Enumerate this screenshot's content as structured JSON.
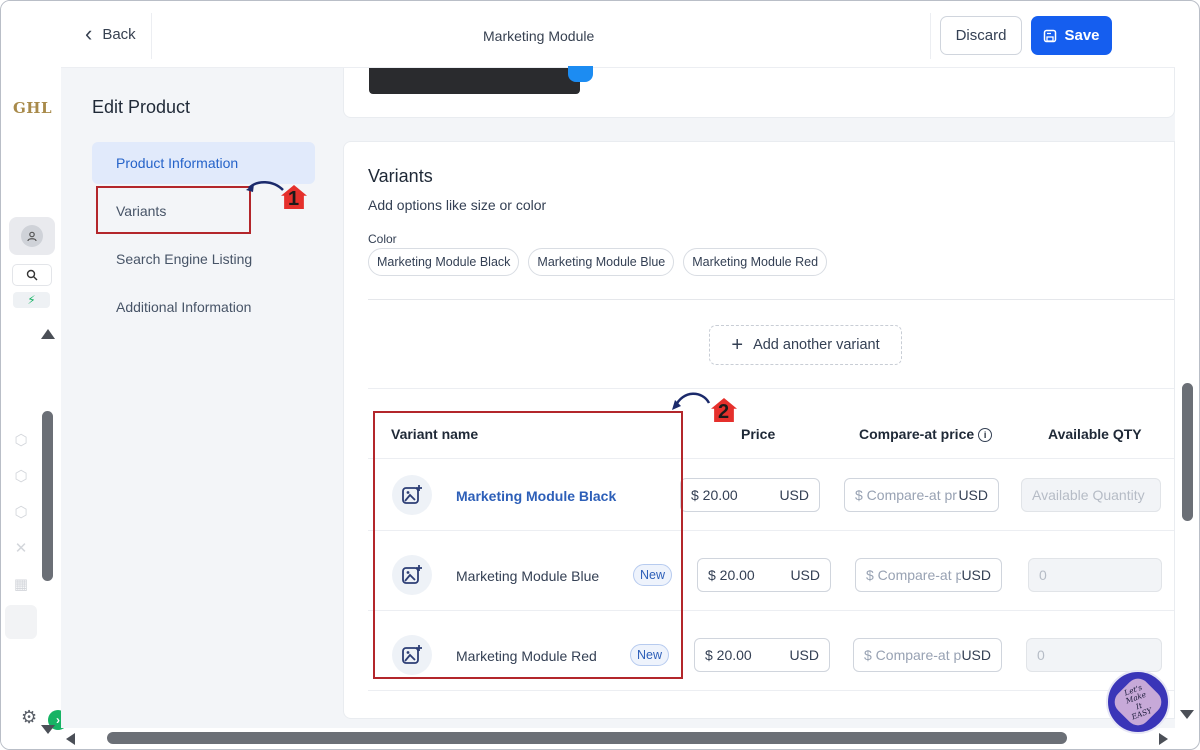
{
  "logo": "GHL",
  "topbar": {
    "back_label": "Back",
    "title": "Marketing Module",
    "discard_label": "Discard",
    "save_label": "Save"
  },
  "nav": {
    "title": "Edit Product",
    "items": [
      {
        "label": "Product Information",
        "active": true
      },
      {
        "label": "Variants",
        "active": false
      },
      {
        "label": "Search Engine Listing",
        "active": false
      },
      {
        "label": "Additional Information",
        "active": false
      }
    ]
  },
  "annotations": {
    "step1": "1",
    "step2": "2"
  },
  "variants": {
    "title": "Variants",
    "subtitle": "Add options like size or color",
    "option_label": "Color",
    "chips": [
      "Marketing Module Black",
      "Marketing Module Blue",
      "Marketing Module Red"
    ],
    "add_label": "Add another variant",
    "columns": {
      "name": "Variant name",
      "price": "Price",
      "compare": "Compare-at price",
      "qty": "Available QTY"
    },
    "rows": [
      {
        "name": "Marketing Module Black",
        "badge": "",
        "price": "$ 20.00",
        "currency": "USD",
        "compare_placeholder": "$ Compare-at pr",
        "compare_currency": "USD",
        "qty": "Available Quantity"
      },
      {
        "name": "Marketing Module Blue",
        "badge": "New",
        "price": "$ 20.00",
        "currency": "USD",
        "compare_placeholder": "$ Compare-at p",
        "compare_currency": "USD",
        "qty": "0"
      },
      {
        "name": "Marketing Module Red",
        "badge": "New",
        "price": "$ 20.00",
        "currency": "USD",
        "compare_placeholder": "$ Compare-at p",
        "compare_currency": "USD",
        "qty": "0"
      }
    ]
  },
  "watermark": {
    "line1": "Let's Make",
    "line2": "It",
    "line3": "EASY"
  },
  "colors": {
    "accent": "#155eef",
    "annotation_red": "#b3262b",
    "link_blue": "#2d5fb8"
  }
}
